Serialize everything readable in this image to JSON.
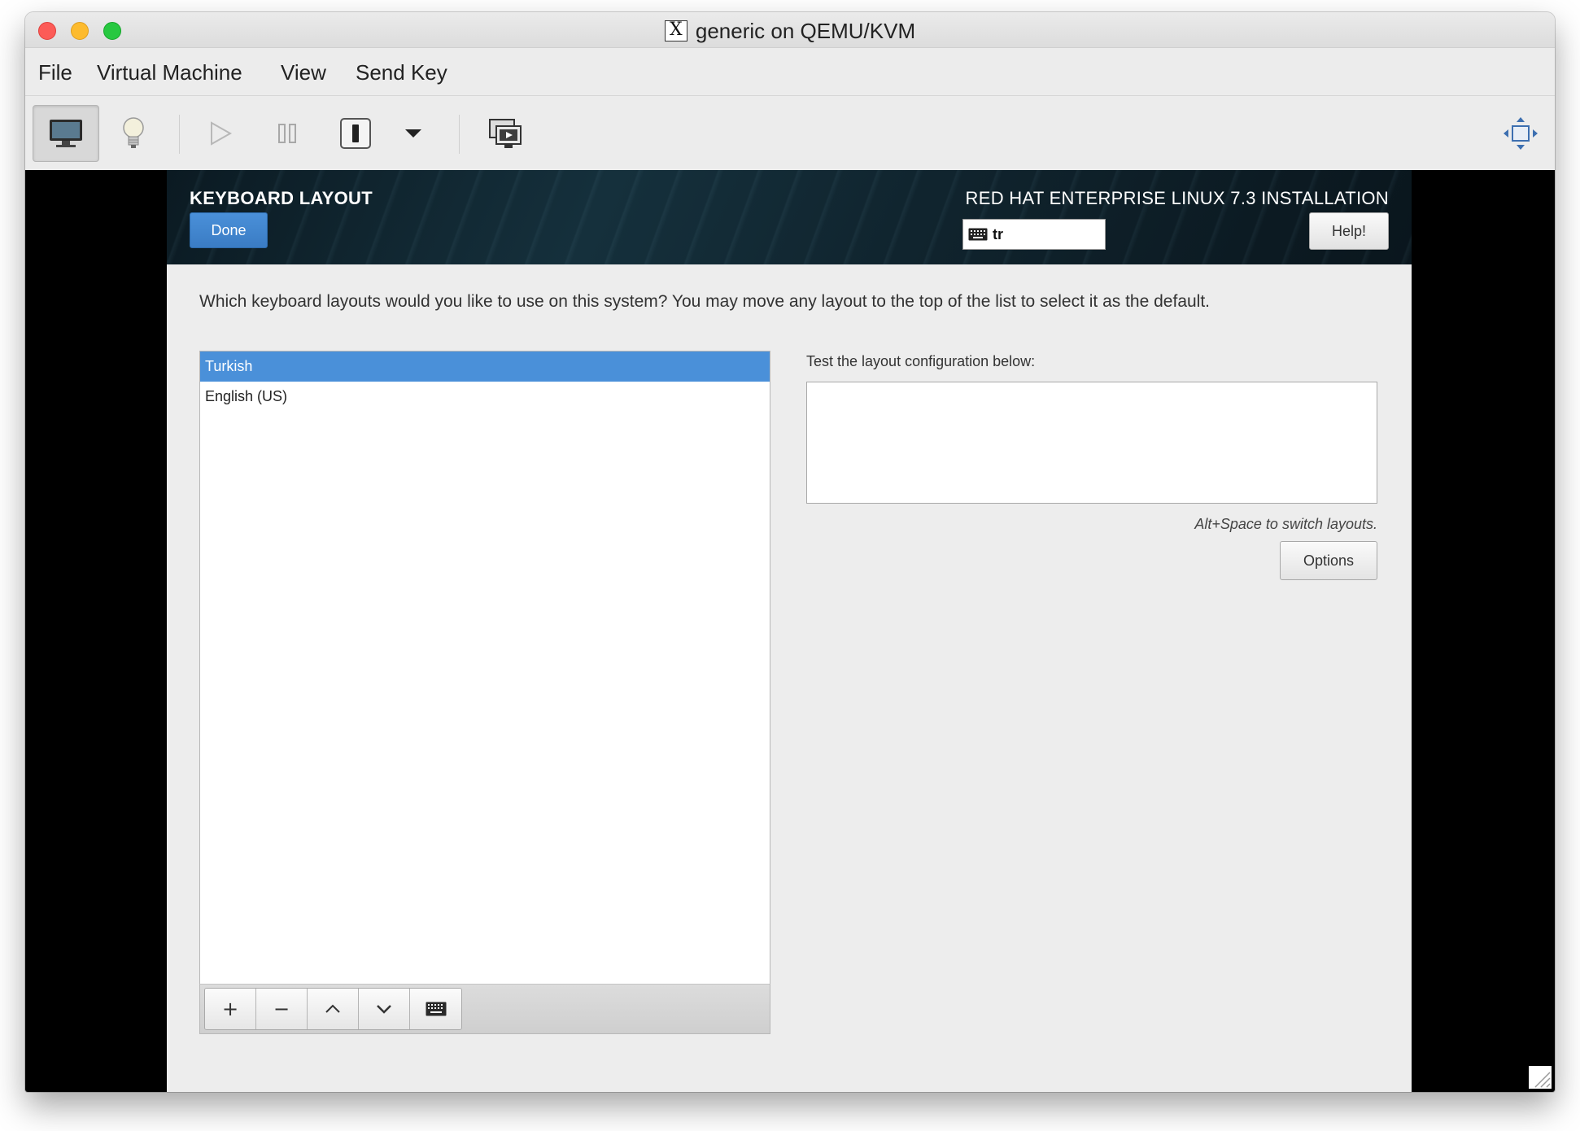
{
  "window": {
    "title": "generic on QEMU/KVM",
    "title_icon_glyph": "X"
  },
  "menubar": {
    "items": [
      "File",
      "Virtual Machine",
      "View",
      "Send Key"
    ]
  },
  "toolbar": {
    "buttons": [
      {
        "name": "console-icon",
        "active": true
      },
      {
        "name": "lightbulb-icon",
        "active": false
      },
      {
        "name": "play-icon",
        "active": false
      },
      {
        "name": "pause-icon",
        "active": false
      },
      {
        "name": "power-icon",
        "active": false
      },
      {
        "name": "chevron-down-icon",
        "active": false
      },
      {
        "name": "screenshot-icon",
        "active": false
      },
      {
        "name": "fullscreen-icon",
        "active": false
      }
    ]
  },
  "installer": {
    "spoke_title": "KEYBOARD LAYOUT",
    "done_label": "Done",
    "product_title": "RED HAT ENTERPRISE LINUX 7.3 INSTALLATION",
    "layout_indicator_value": "tr",
    "help_label": "Help!",
    "prompt": "Which keyboard layouts would you like to use on this system?  You may move any layout to the top of the list to select it as the default.",
    "layouts": [
      {
        "label": "Turkish",
        "selected": true
      },
      {
        "label": "English (US)",
        "selected": false
      }
    ],
    "list_tools": [
      {
        "name": "add-layout-button",
        "glyph": "+"
      },
      {
        "name": "remove-layout-button",
        "glyph": "−"
      },
      {
        "name": "move-up-button",
        "glyph": "⌃"
      },
      {
        "name": "move-down-button",
        "glyph": "⌄"
      },
      {
        "name": "preview-layout-button",
        "glyph": "⌨"
      }
    ],
    "test_label": "Test the layout configuration below:",
    "test_value": "",
    "hint": "Alt+Space to switch layouts.",
    "options_label": "Options"
  },
  "colors": {
    "accent": "#4a90d9",
    "header_dark": "#10242e"
  }
}
